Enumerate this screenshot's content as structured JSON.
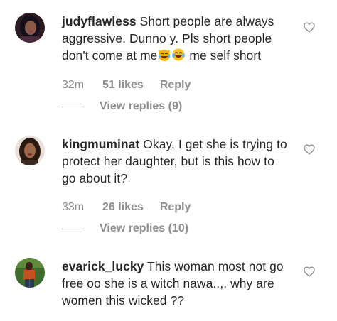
{
  "comments": [
    {
      "username": "judyflawless",
      "text_before_emoji": "Short people are always aggressive. Dunno y. Pls short people don't come at me",
      "emojis": [
        "grinning-cat-with-tears-emoji",
        "face-with-tears-of-joy-emoji"
      ],
      "text_after_emoji": " me self short",
      "time": "32m",
      "likes": "51 likes",
      "reply_label": "Reply",
      "view_replies": "View replies (9)"
    },
    {
      "username": "kingmuminat",
      "text": "Okay, I get she is trying to protect her daughter, but is this how to go about it?",
      "time": "33m",
      "likes": "26 likes",
      "reply_label": "Reply",
      "view_replies": "View replies (10)"
    },
    {
      "username": "evarick_lucky",
      "text": "This woman most not go free oo she is a witch nawa..,. why are women this wicked ??"
    }
  ],
  "icons": {
    "like": "heart-outline-icon"
  },
  "colors": {
    "text": "#262626",
    "secondary": "#8e8e8e"
  }
}
